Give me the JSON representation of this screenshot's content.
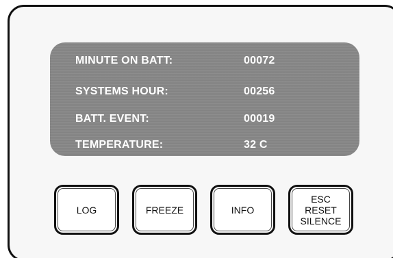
{
  "display": {
    "rows": [
      {
        "label": "MINUTE ON BATT:",
        "value": "00072"
      },
      {
        "label": "SYSTEMS HOUR:",
        "value": "00256"
      },
      {
        "label": "BATT. EVENT:",
        "value": "00019"
      },
      {
        "label": "TEMPERATURE:",
        "value": "32 C"
      }
    ]
  },
  "buttons": {
    "log": "LOG",
    "freeze": "FREEZE",
    "info": "INFO",
    "esc_lines": [
      "ESC",
      "RESET",
      "SILENCE"
    ]
  },
  "colors": {
    "display_bg": "#878787",
    "display_text": "#ffffff",
    "border": "#111111"
  }
}
